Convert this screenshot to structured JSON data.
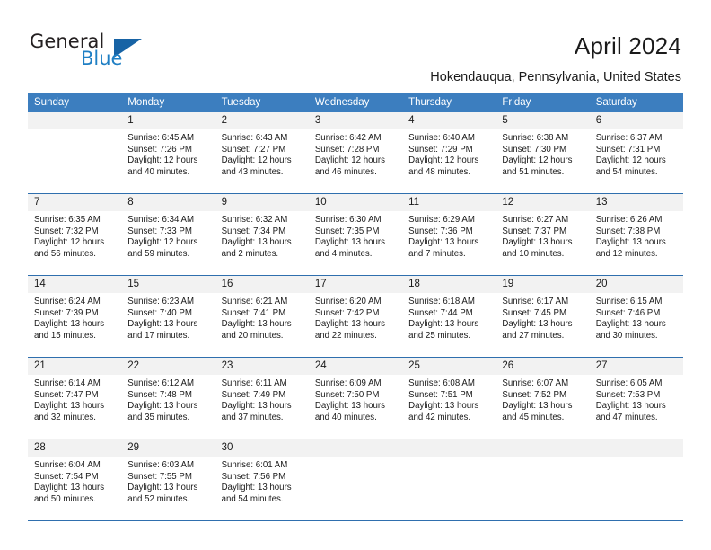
{
  "brand": {
    "name_top": "General",
    "name_bottom": "Blue",
    "accent_color": "#1763a5",
    "text_color": "#231f20"
  },
  "header": {
    "title": "April 2024",
    "subtitle": "Hokendauqua, Pennsylvania, United States"
  },
  "calendar": {
    "header_bg": "#3c7ebf",
    "header_text": "#ffffff",
    "numbers_bg": "#f2f2f2",
    "separator_color": "#2f6fae",
    "weekdays": [
      "Sunday",
      "Monday",
      "Tuesday",
      "Wednesday",
      "Thursday",
      "Friday",
      "Saturday"
    ],
    "weeks": [
      {
        "days": [
          {
            "num": "",
            "lines": []
          },
          {
            "num": "1",
            "lines": [
              "Sunrise: 6:45 AM",
              "Sunset: 7:26 PM",
              "Daylight: 12 hours",
              "and 40 minutes."
            ]
          },
          {
            "num": "2",
            "lines": [
              "Sunrise: 6:43 AM",
              "Sunset: 7:27 PM",
              "Daylight: 12 hours",
              "and 43 minutes."
            ]
          },
          {
            "num": "3",
            "lines": [
              "Sunrise: 6:42 AM",
              "Sunset: 7:28 PM",
              "Daylight: 12 hours",
              "and 46 minutes."
            ]
          },
          {
            "num": "4",
            "lines": [
              "Sunrise: 6:40 AM",
              "Sunset: 7:29 PM",
              "Daylight: 12 hours",
              "and 48 minutes."
            ]
          },
          {
            "num": "5",
            "lines": [
              "Sunrise: 6:38 AM",
              "Sunset: 7:30 PM",
              "Daylight: 12 hours",
              "and 51 minutes."
            ]
          },
          {
            "num": "6",
            "lines": [
              "Sunrise: 6:37 AM",
              "Sunset: 7:31 PM",
              "Daylight: 12 hours",
              "and 54 minutes."
            ]
          }
        ]
      },
      {
        "days": [
          {
            "num": "7",
            "lines": [
              "Sunrise: 6:35 AM",
              "Sunset: 7:32 PM",
              "Daylight: 12 hours",
              "and 56 minutes."
            ]
          },
          {
            "num": "8",
            "lines": [
              "Sunrise: 6:34 AM",
              "Sunset: 7:33 PM",
              "Daylight: 12 hours",
              "and 59 minutes."
            ]
          },
          {
            "num": "9",
            "lines": [
              "Sunrise: 6:32 AM",
              "Sunset: 7:34 PM",
              "Daylight: 13 hours",
              "and 2 minutes."
            ]
          },
          {
            "num": "10",
            "lines": [
              "Sunrise: 6:30 AM",
              "Sunset: 7:35 PM",
              "Daylight: 13 hours",
              "and 4 minutes."
            ]
          },
          {
            "num": "11",
            "lines": [
              "Sunrise: 6:29 AM",
              "Sunset: 7:36 PM",
              "Daylight: 13 hours",
              "and 7 minutes."
            ]
          },
          {
            "num": "12",
            "lines": [
              "Sunrise: 6:27 AM",
              "Sunset: 7:37 PM",
              "Daylight: 13 hours",
              "and 10 minutes."
            ]
          },
          {
            "num": "13",
            "lines": [
              "Sunrise: 6:26 AM",
              "Sunset: 7:38 PM",
              "Daylight: 13 hours",
              "and 12 minutes."
            ]
          }
        ]
      },
      {
        "days": [
          {
            "num": "14",
            "lines": [
              "Sunrise: 6:24 AM",
              "Sunset: 7:39 PM",
              "Daylight: 13 hours",
              "and 15 minutes."
            ]
          },
          {
            "num": "15",
            "lines": [
              "Sunrise: 6:23 AM",
              "Sunset: 7:40 PM",
              "Daylight: 13 hours",
              "and 17 minutes."
            ]
          },
          {
            "num": "16",
            "lines": [
              "Sunrise: 6:21 AM",
              "Sunset: 7:41 PM",
              "Daylight: 13 hours",
              "and 20 minutes."
            ]
          },
          {
            "num": "17",
            "lines": [
              "Sunrise: 6:20 AM",
              "Sunset: 7:42 PM",
              "Daylight: 13 hours",
              "and 22 minutes."
            ]
          },
          {
            "num": "18",
            "lines": [
              "Sunrise: 6:18 AM",
              "Sunset: 7:44 PM",
              "Daylight: 13 hours",
              "and 25 minutes."
            ]
          },
          {
            "num": "19",
            "lines": [
              "Sunrise: 6:17 AM",
              "Sunset: 7:45 PM",
              "Daylight: 13 hours",
              "and 27 minutes."
            ]
          },
          {
            "num": "20",
            "lines": [
              "Sunrise: 6:15 AM",
              "Sunset: 7:46 PM",
              "Daylight: 13 hours",
              "and 30 minutes."
            ]
          }
        ]
      },
      {
        "days": [
          {
            "num": "21",
            "lines": [
              "Sunrise: 6:14 AM",
              "Sunset: 7:47 PM",
              "Daylight: 13 hours",
              "and 32 minutes."
            ]
          },
          {
            "num": "22",
            "lines": [
              "Sunrise: 6:12 AM",
              "Sunset: 7:48 PM",
              "Daylight: 13 hours",
              "and 35 minutes."
            ]
          },
          {
            "num": "23",
            "lines": [
              "Sunrise: 6:11 AM",
              "Sunset: 7:49 PM",
              "Daylight: 13 hours",
              "and 37 minutes."
            ]
          },
          {
            "num": "24",
            "lines": [
              "Sunrise: 6:09 AM",
              "Sunset: 7:50 PM",
              "Daylight: 13 hours",
              "and 40 minutes."
            ]
          },
          {
            "num": "25",
            "lines": [
              "Sunrise: 6:08 AM",
              "Sunset: 7:51 PM",
              "Daylight: 13 hours",
              "and 42 minutes."
            ]
          },
          {
            "num": "26",
            "lines": [
              "Sunrise: 6:07 AM",
              "Sunset: 7:52 PM",
              "Daylight: 13 hours",
              "and 45 minutes."
            ]
          },
          {
            "num": "27",
            "lines": [
              "Sunrise: 6:05 AM",
              "Sunset: 7:53 PM",
              "Daylight: 13 hours",
              "and 47 minutes."
            ]
          }
        ]
      },
      {
        "days": [
          {
            "num": "28",
            "lines": [
              "Sunrise: 6:04 AM",
              "Sunset: 7:54 PM",
              "Daylight: 13 hours",
              "and 50 minutes."
            ]
          },
          {
            "num": "29",
            "lines": [
              "Sunrise: 6:03 AM",
              "Sunset: 7:55 PM",
              "Daylight: 13 hours",
              "and 52 minutes."
            ]
          },
          {
            "num": "30",
            "lines": [
              "Sunrise: 6:01 AM",
              "Sunset: 7:56 PM",
              "Daylight: 13 hours",
              "and 54 minutes."
            ]
          },
          {
            "num": "",
            "lines": []
          },
          {
            "num": "",
            "lines": []
          },
          {
            "num": "",
            "lines": []
          },
          {
            "num": "",
            "lines": []
          }
        ]
      }
    ]
  }
}
